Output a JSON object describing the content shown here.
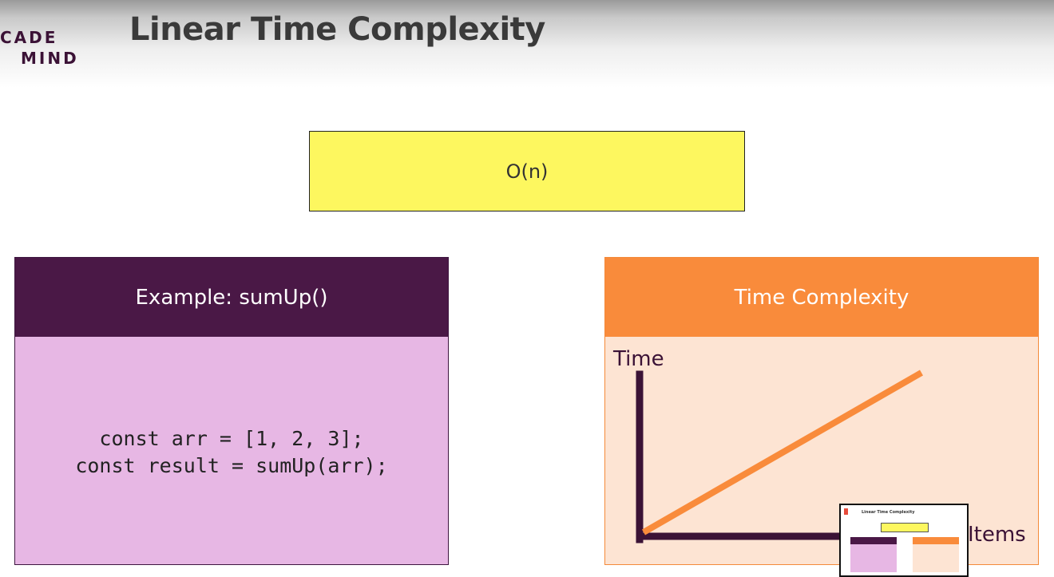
{
  "header": {
    "logo_line1": "CADE",
    "logo_line2": "MIND",
    "title": "Linear Time Complexity"
  },
  "complexity_box": {
    "label": "O(n)"
  },
  "example_card": {
    "title": "Example: sumUp()",
    "code_line1": "const arr = [1, 2, 3];",
    "code_line2": "const result = sumUp(arr);"
  },
  "chart_card": {
    "title": "Time Complexity",
    "y_label": "Time",
    "x_label": "Items"
  },
  "chart_data": {
    "type": "line",
    "xlabel": "Items",
    "ylabel": "Time",
    "series": [
      {
        "x": [
          0,
          1
        ],
        "values": [
          0,
          1
        ]
      }
    ]
  },
  "colors": {
    "accent_yellow": "#fdf75f",
    "purple_dark": "#4a1846",
    "purple_light": "#e7b7e4",
    "orange": "#f98b3b",
    "orange_light": "#fde4d3"
  }
}
